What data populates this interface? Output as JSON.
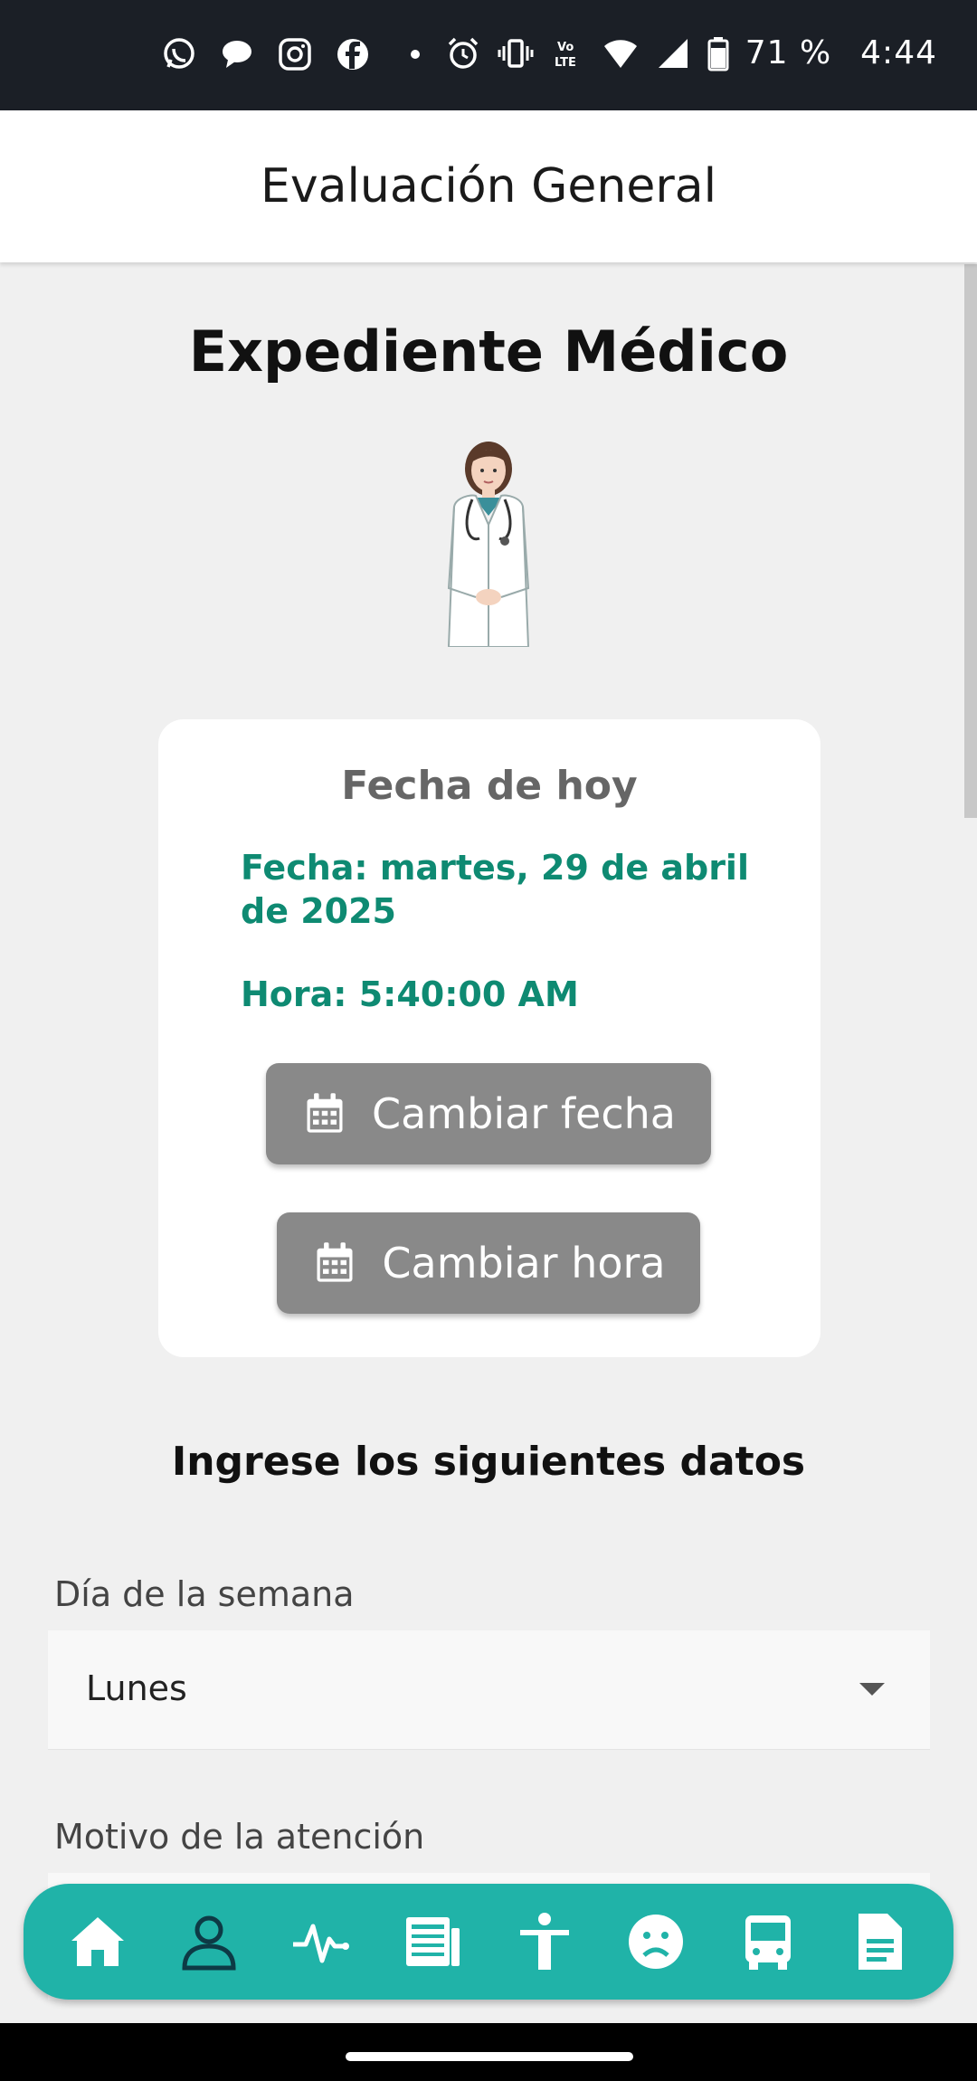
{
  "status_bar": {
    "battery": "71 %",
    "time": "4:44",
    "icons": [
      "whatsapp-icon",
      "messages-icon",
      "instagram-icon",
      "facebook-icon",
      "alarm-icon",
      "vibrate-icon",
      "volte-icon",
      "wifi-icon",
      "signal-icon",
      "battery-icon"
    ]
  },
  "app_bar": {
    "title": "Evaluación General"
  },
  "page": {
    "heading": "Expediente Médico"
  },
  "date_card": {
    "title": "Fecha de hoy",
    "fecha": "Fecha: martes, 29 de abril de 2025",
    "hora": "Hora: 5:40:00 AM",
    "change_date_label": "Cambiar fecha",
    "change_time_label": "Cambiar hora"
  },
  "form": {
    "heading": "Ingrese los siguientes datos",
    "dia_label": "Día de la semana",
    "dia_value": "Lunes",
    "motivo_label": "Motivo de la atención"
  },
  "bottom_nav": {
    "items": [
      "home-icon",
      "person-icon",
      "pulse-icon",
      "newspaper-icon",
      "accessibility-icon",
      "sad-face-icon",
      "bus-icon",
      "document-icon"
    ],
    "active": "person-icon"
  },
  "colors": {
    "accent": "#20b3a8",
    "date_text": "#0e8a72",
    "button": "#898989"
  }
}
